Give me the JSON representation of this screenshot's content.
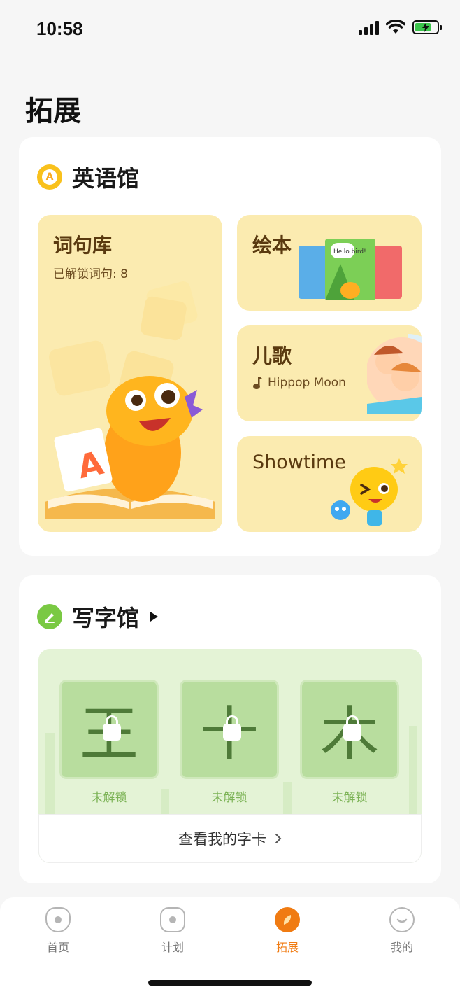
{
  "status_bar": {
    "time": "10:58"
  },
  "page_title": "拓展",
  "english": {
    "badge": "A",
    "title": "英语馆",
    "phrasebank": {
      "title": "词句库",
      "subtitle": "已解锁词句: 8",
      "flashcard_letter": "A"
    },
    "picture_book": {
      "title": "绘本",
      "book_text": "Hello bird!"
    },
    "nursery_rhyme": {
      "title": "儿歌",
      "song": "Hippop Moon"
    },
    "showtime": {
      "title": "Showtime"
    }
  },
  "writing": {
    "title": "写字馆",
    "characters": [
      {
        "glyph": "王",
        "status": "未解锁"
      },
      {
        "glyph": "十",
        "status": "未解锁"
      },
      {
        "glyph": "木",
        "status": "未解锁"
      }
    ],
    "view_cards_label": "查看我的字卡"
  },
  "tabbar": {
    "items": [
      {
        "label": "首页",
        "icon": "home-icon",
        "active": false
      },
      {
        "label": "计划",
        "icon": "plan-icon",
        "active": false
      },
      {
        "label": "拓展",
        "icon": "explore-icon",
        "active": true
      },
      {
        "label": "我的",
        "icon": "profile-icon",
        "active": false
      }
    ],
    "active_color": "#f07b12",
    "inactive_color": "#777777"
  },
  "colors": {
    "english_badge": "#f9c11c",
    "writing_badge": "#7ac943",
    "tile_yellow": "#fbebb0",
    "writing_bg": "#e4f3d6"
  }
}
